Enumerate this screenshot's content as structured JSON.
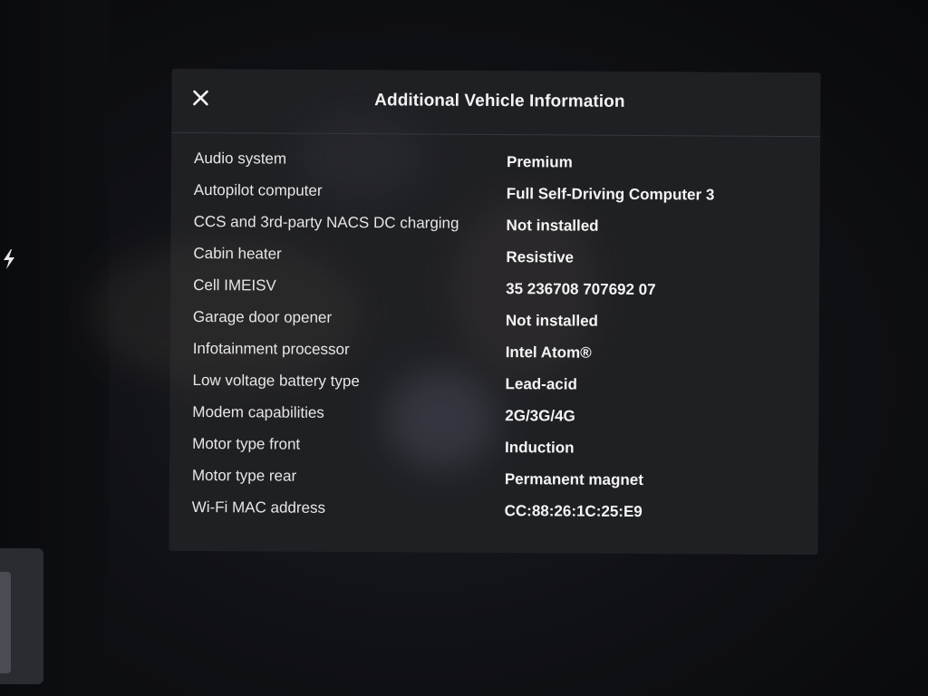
{
  "modal": {
    "title": "Additional Vehicle Information",
    "close_icon": "close-icon"
  },
  "info": [
    {
      "label": "Audio system",
      "value": "Premium"
    },
    {
      "label": "Autopilot computer",
      "value": "Full Self-Driving Computer 3"
    },
    {
      "label": "CCS and 3rd-party NACS DC charging",
      "value": "Not installed"
    },
    {
      "label": "Cabin heater",
      "value": "Resistive"
    },
    {
      "label": "Cell IMEISV",
      "value": "35 236708 707692 07"
    },
    {
      "label": "Garage door opener",
      "value": "Not installed"
    },
    {
      "label": "Infotainment processor",
      "value": "Intel Atom®"
    },
    {
      "label": "Low voltage battery type",
      "value": "Lead-acid"
    },
    {
      "label": "Modem capabilities",
      "value": "2G/3G/4G"
    },
    {
      "label": "Motor type front",
      "value": "Induction"
    },
    {
      "label": "Motor type rear",
      "value": "Permanent magnet"
    },
    {
      "label": "Wi-Fi MAC address",
      "value": "CC:88:26:1C:25:E9"
    }
  ],
  "background": {
    "bolt_icon": "bolt-icon",
    "side_card": "side-card"
  },
  "colors": {
    "modal_bg": "#1f2024",
    "screen_bg": "#0b0c10",
    "text": "#f2f2f2"
  }
}
